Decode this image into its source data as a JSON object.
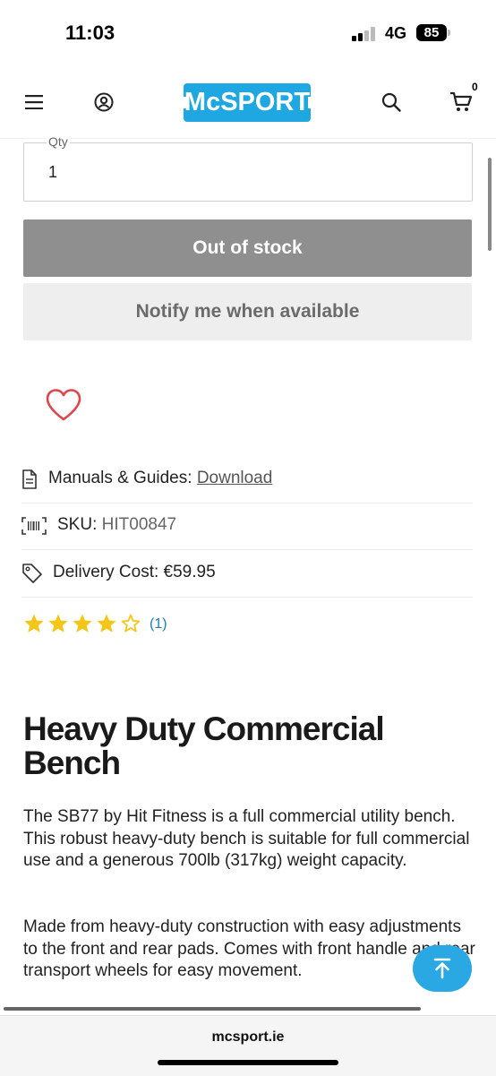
{
  "status": {
    "time": "11:03",
    "network": "4G",
    "battery": "85"
  },
  "header": {
    "logo": "McSPORT",
    "cart_count": "0"
  },
  "product_form": {
    "qty_label": "Qty",
    "qty_value": "1",
    "out_of_stock_label": "Out of stock",
    "notify_label": "Notify me when available"
  },
  "info": {
    "manuals_label": "Manuals & Guides:",
    "manuals_link": "Download",
    "sku_label": "SKU:",
    "sku_value": "HIT00847",
    "delivery_label": "Delivery Cost:",
    "delivery_value": "€59.95"
  },
  "rating": {
    "stars": 4,
    "max": 5,
    "review_count": "(1)"
  },
  "product": {
    "title": "Heavy Duty Commercial Bench",
    "description_1": "The SB77 by Hit Fitness is a full commercial utility bench. This robust heavy-duty bench is suitable for full commercial use and a generous 700lb (317kg) weight capacity.",
    "description_2": "Made from heavy-duty construction with easy adjustments to the front and rear pads. Comes with front handle and rear transport wheels for easy movement."
  },
  "browser": {
    "url": "mcsport.ie"
  },
  "colors": {
    "brand": "#1ea7e1",
    "star": "#f5c518",
    "heart": "#e0454a"
  }
}
